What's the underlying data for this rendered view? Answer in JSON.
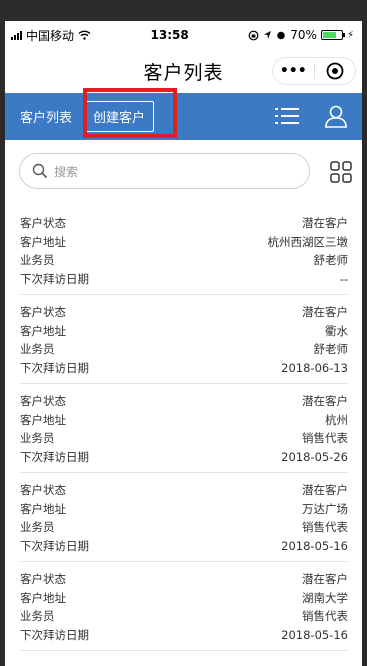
{
  "status_bar": {
    "carrier": "中国移动",
    "time": "13:58",
    "battery": "70%",
    "battery_level": 0.7
  },
  "nav": {
    "title": "客户列表",
    "more": "•••"
  },
  "tabs": {
    "list_label": "客户列表",
    "create_label": "创建客户"
  },
  "search": {
    "placeholder": "搜索"
  },
  "customers": [
    {
      "status_label": "客户状态",
      "status": "潜在客户",
      "address_label": "客户地址",
      "address": "杭州西湖区三墩",
      "sales_label": "业务员",
      "sales": "舒老师",
      "visit_label": "下次拜访日期",
      "visit": "--"
    },
    {
      "status_label": "客户状态",
      "status": "潜在客户",
      "address_label": "客户地址",
      "address": "衢水",
      "sales_label": "业务员",
      "sales": "舒老师",
      "visit_label": "下次拜访日期",
      "visit": "2018-06-13"
    },
    {
      "status_label": "客户状态",
      "status": "潜在客户",
      "address_label": "客户地址",
      "address": "杭州",
      "sales_label": "业务员",
      "sales": "销售代表",
      "visit_label": "下次拜访日期",
      "visit": "2018-05-26"
    },
    {
      "status_label": "客户状态",
      "status": "潜在客户",
      "address_label": "客户地址",
      "address": "万达广场",
      "sales_label": "业务员",
      "sales": "销售代表",
      "visit_label": "下次拜访日期",
      "visit": "2018-05-16"
    },
    {
      "status_label": "客户状态",
      "status": "潜在客户",
      "address_label": "客户地址",
      "address": "湖南大学",
      "sales_label": "业务员",
      "sales": "销售代表",
      "visit_label": "下次拜访日期",
      "visit": "2018-05-16"
    }
  ],
  "colors": {
    "tab_bar": "#3c7ac5",
    "highlight": "#e02020",
    "battery_fill": "#4cd964"
  }
}
